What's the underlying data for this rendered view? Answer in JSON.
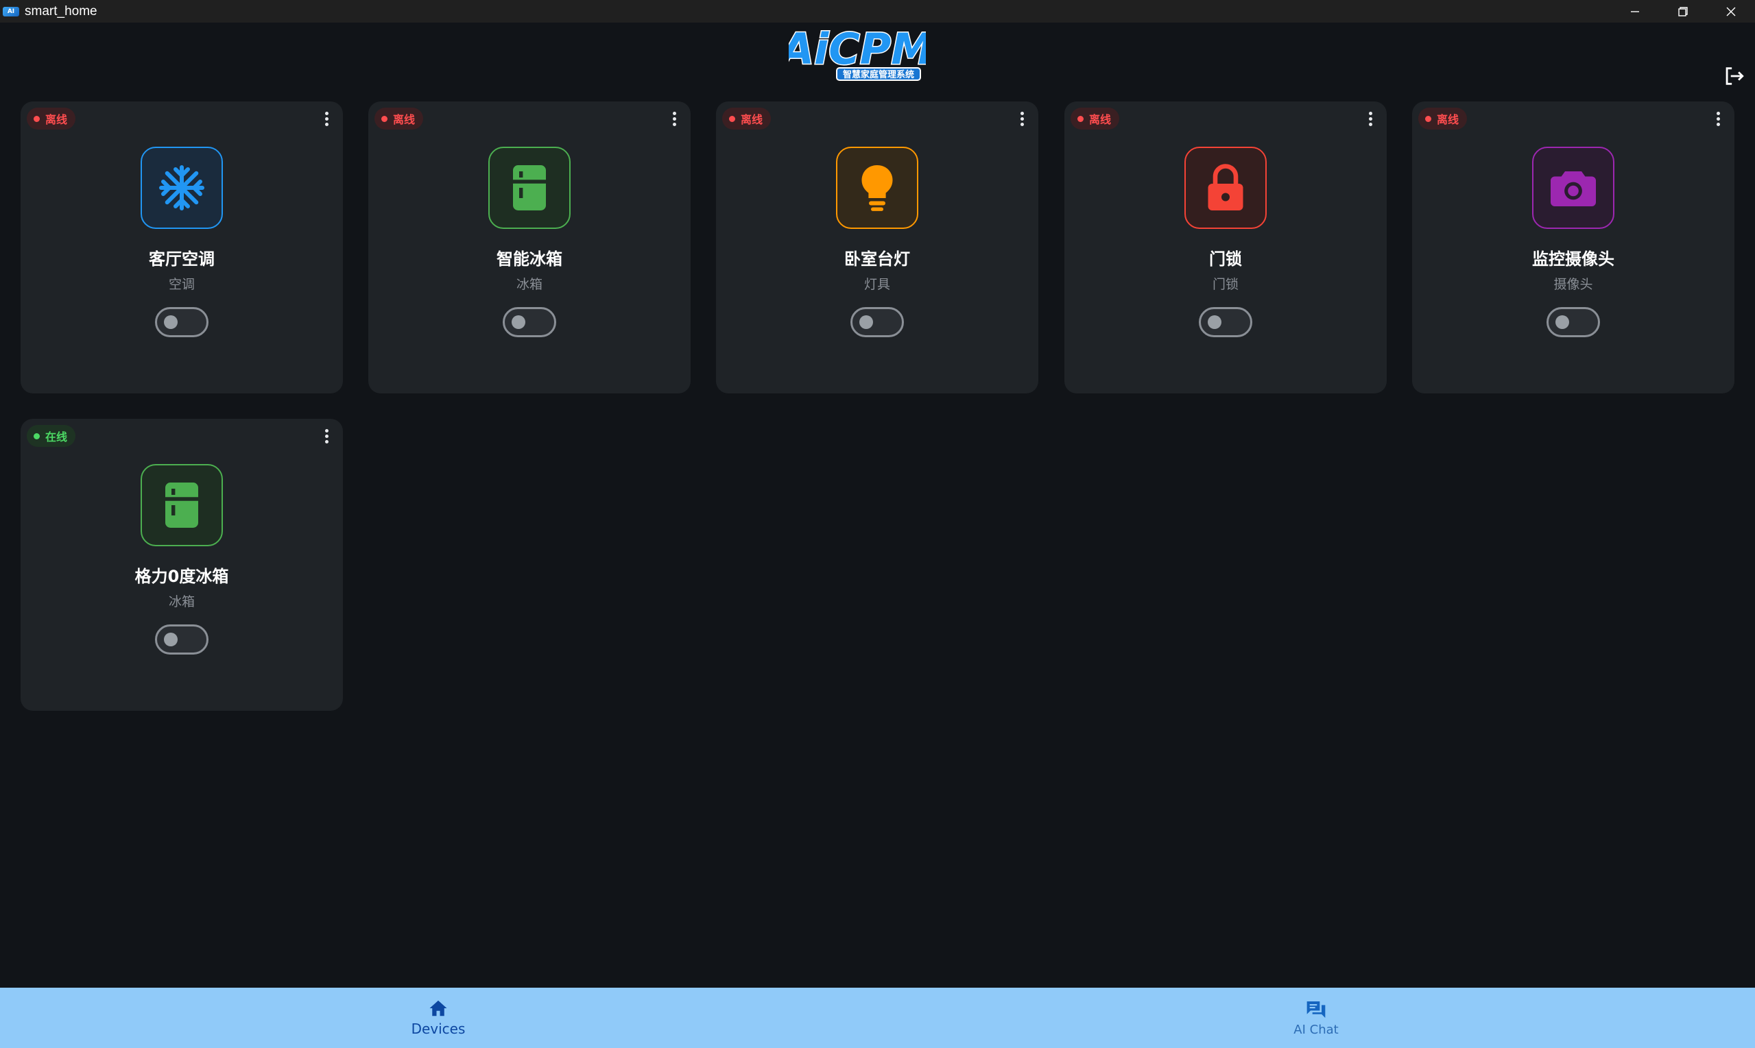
{
  "window": {
    "title": "smart_home",
    "icon": "app-logo-icon"
  },
  "header": {
    "logo": {
      "text": "AiCPM",
      "subtitle": "智慧家庭管理系统"
    },
    "logout_icon": "logout-icon"
  },
  "colors": {
    "offline": "#ff4d4f",
    "online": "#4cd964",
    "ac": "#2196f3",
    "fridge": "#4caf50",
    "lamp": "#ff9800",
    "lock": "#f44336",
    "camera": "#9c27b0",
    "nav_bg": "#90caf9"
  },
  "devices": [
    {
      "status": "离线",
      "name": "客厅空调",
      "type": "空调",
      "icon": "snowflake-icon",
      "on": false
    },
    {
      "status": "离线",
      "name": "智能冰箱",
      "type": "冰箱",
      "icon": "fridge-icon",
      "on": false
    },
    {
      "status": "离线",
      "name": "卧室台灯",
      "type": "灯具",
      "icon": "lightbulb-icon",
      "on": false
    },
    {
      "status": "离线",
      "name": "门锁",
      "type": "门锁",
      "icon": "lock-icon",
      "on": false
    },
    {
      "status": "离线",
      "name": "监控摄像头",
      "type": "摄像头",
      "icon": "camera-icon",
      "on": false
    },
    {
      "status": "在线",
      "name": "格力0度冰箱",
      "type": "冰箱",
      "icon": "fridge-icon",
      "on": false
    }
  ],
  "nav": {
    "items": [
      {
        "label": "Devices",
        "icon": "home-icon",
        "active": true
      },
      {
        "label": "AI Chat",
        "icon": "chat-icon",
        "active": false
      }
    ]
  }
}
